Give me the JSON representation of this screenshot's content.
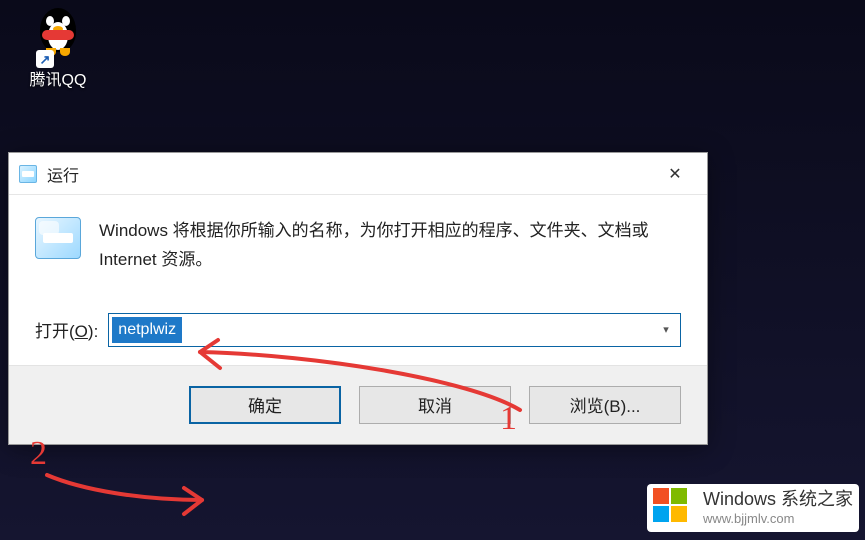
{
  "desktop": {
    "icon_label": "腾讯QQ"
  },
  "run_dialog": {
    "title": "运行",
    "description": "Windows 将根据你所输入的名称，为你打开相应的程序、文件夹、文档或 Internet 资源。",
    "open_label_prefix": "打开(",
    "open_label_accel": "O",
    "open_label_suffix": "):",
    "input_value": "netplwiz",
    "buttons": {
      "ok": "确定",
      "cancel": "取消",
      "browse": "浏览(B)..."
    }
  },
  "annotations": {
    "num1": "1",
    "num2": "2"
  },
  "watermark": {
    "line1": "Windows 系统之家",
    "line2": "www.bjjmlv.com"
  },
  "colors": {
    "annotation": "#e53935",
    "select_bg": "#1e79c8",
    "border_focus": "#0a64a4"
  }
}
